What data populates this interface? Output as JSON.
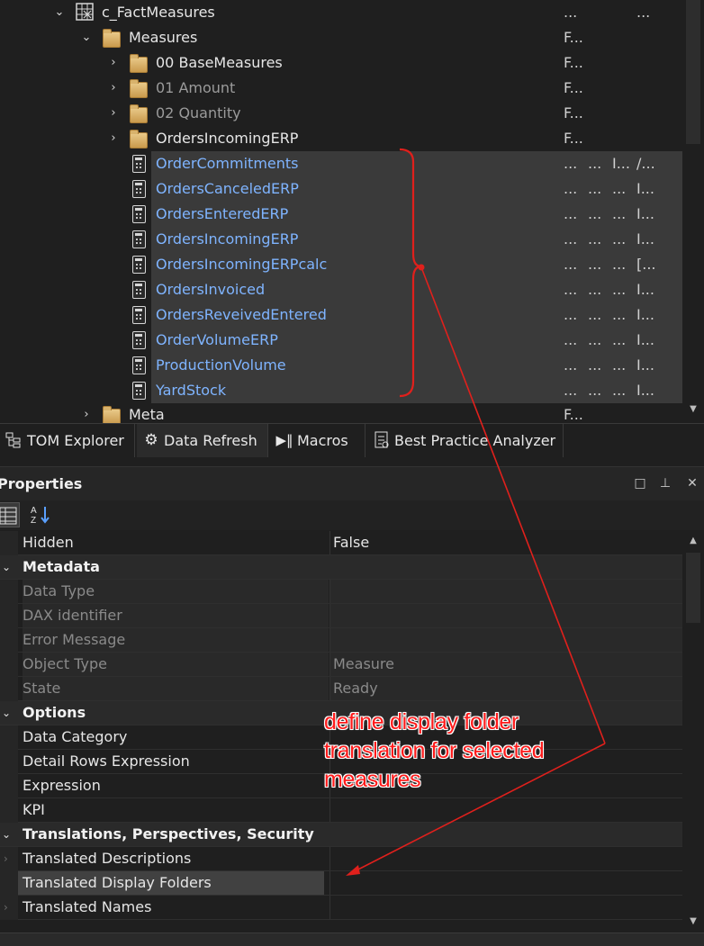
{
  "tree": {
    "rows": [
      {
        "label": "c_FactMeasures",
        "c1": "...",
        "c2": "",
        "c3": "",
        "c4": "..."
      },
      {
        "label": "Measures",
        "c1": "F..."
      },
      {
        "label": "00 BaseMeasures",
        "c1": "F..."
      },
      {
        "label": "01 Amount",
        "c1": "F..."
      },
      {
        "label": "02 Quantity",
        "c1": "F..."
      },
      {
        "label": "OrdersIncomingERP",
        "c1": "F..."
      },
      {
        "label": "OrderCommitments",
        "c1": "...",
        "c2": "...",
        "c3": "I...",
        "c4": "/..."
      },
      {
        "label": "OrdersCanceledERP",
        "c1": "...",
        "c2": "...",
        "c3": "...",
        "c4": "I..."
      },
      {
        "label": "OrdersEnteredERP",
        "c1": "...",
        "c2": "...",
        "c3": "...",
        "c4": "I..."
      },
      {
        "label": "OrdersIncomingERP",
        "c1": "...",
        "c2": "...",
        "c3": "...",
        "c4": "I..."
      },
      {
        "label": "OrdersIncomingERPcalc",
        "c1": "...",
        "c2": "...",
        "c3": "...",
        "c4": "[..."
      },
      {
        "label": "OrdersInvoiced",
        "c1": "...",
        "c2": "...",
        "c3": "...",
        "c4": "I..."
      },
      {
        "label": "OrdersReveivedEntered",
        "c1": "...",
        "c2": "...",
        "c3": "...",
        "c4": "I..."
      },
      {
        "label": "OrderVolumeERP",
        "c1": "...",
        "c2": "...",
        "c3": "...",
        "c4": "I..."
      },
      {
        "label": "ProductionVolume",
        "c1": "...",
        "c2": "...",
        "c3": "...",
        "c4": "I..."
      },
      {
        "label": "YardStock",
        "c1": "...",
        "c2": "...",
        "c3": "...",
        "c4": "I..."
      },
      {
        "label": "Meta",
        "c1": "F..."
      }
    ]
  },
  "tabs": [
    {
      "label": "TOM Explorer",
      "icon": "tree-icon"
    },
    {
      "label": "Data Refresh",
      "icon": "gears-icon"
    },
    {
      "label": "Macros",
      "icon": "macro-icon"
    },
    {
      "label": "Best Practice Analyzer",
      "icon": "analyzer-icon"
    }
  ],
  "properties": {
    "title": "Properties",
    "window_buttons": {
      "maximize": "□",
      "pin": "⊥",
      "close": "✕"
    },
    "rows": [
      {
        "name": "Hidden",
        "value": "False"
      },
      {
        "name": "Metadata",
        "value": ""
      },
      {
        "name": "Data Type",
        "value": ""
      },
      {
        "name": "DAX identifier",
        "value": ""
      },
      {
        "name": "Error Message",
        "value": ""
      },
      {
        "name": "Object Type",
        "value": "Measure"
      },
      {
        "name": "State",
        "value": "Ready"
      },
      {
        "name": "Options",
        "value": ""
      },
      {
        "name": "Data Category",
        "value": ""
      },
      {
        "name": "Detail Rows Expression",
        "value": ""
      },
      {
        "name": "Expression",
        "value": ""
      },
      {
        "name": "KPI",
        "value": ""
      },
      {
        "name": "Translations, Perspectives, Security",
        "value": ""
      },
      {
        "name": "Translated Descriptions",
        "value": ""
      },
      {
        "name": "Translated Display Folders",
        "value": ""
      },
      {
        "name": "Translated Names",
        "value": ""
      }
    ]
  },
  "annotation": {
    "text": "define display folder translation for selected measures",
    "color": "#ff1a1a"
  },
  "colors": {
    "background": "#1f1f1f",
    "selected_text": "#7fb4ff",
    "selected_row": "#3a3a3a"
  }
}
